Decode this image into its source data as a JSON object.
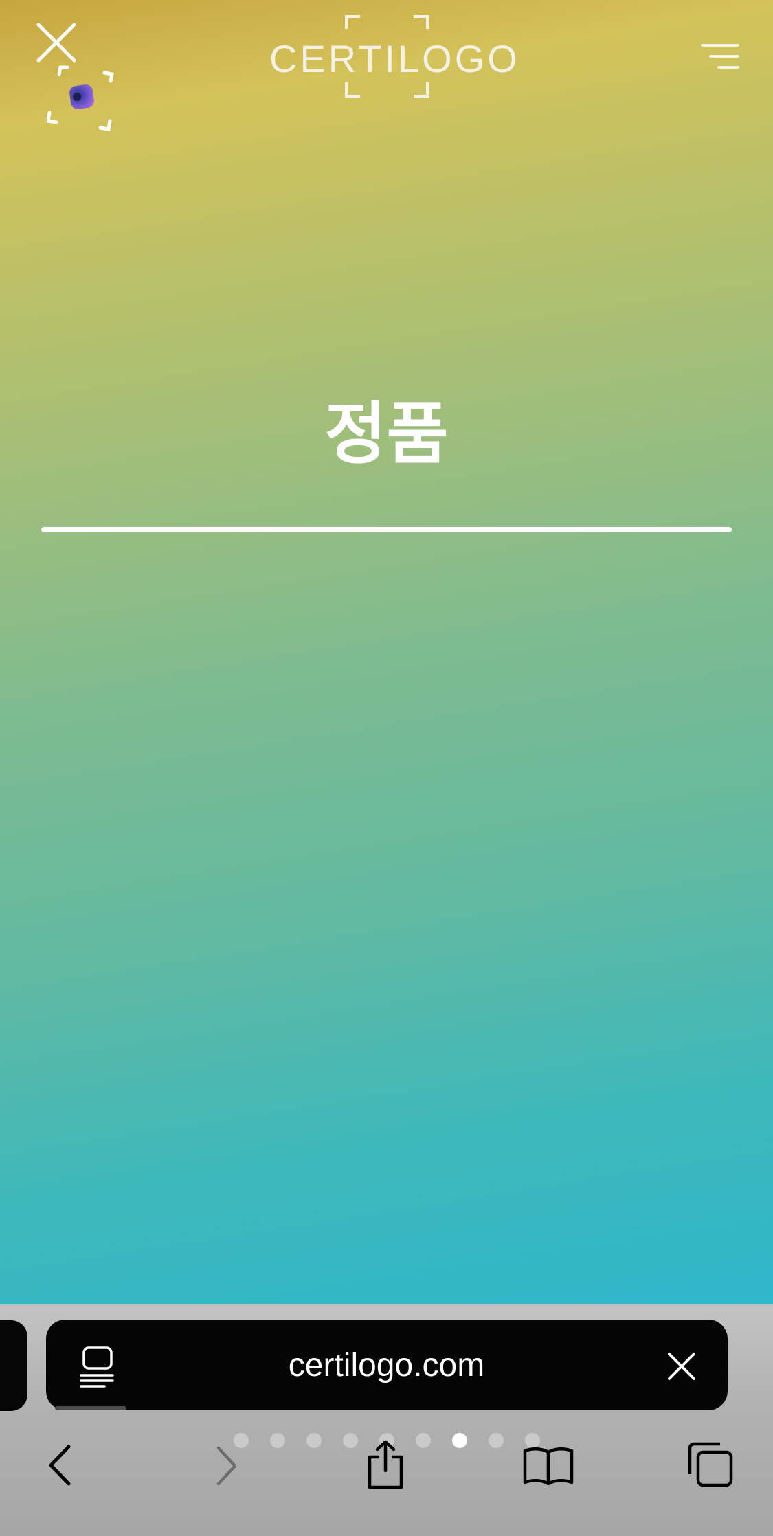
{
  "header": {
    "close_icon": "close-icon",
    "scan_icon": "scan-frame-icon",
    "logo_text": "CERTILOGO",
    "menu_icon": "hamburger-menu-icon"
  },
  "main": {
    "verdict": "정품"
  },
  "browser": {
    "url": "certilogo.com",
    "reader_icon": "reader-mode-icon",
    "clear_icon": "close-icon",
    "tab_count": 9,
    "active_tab_index": 6,
    "toolbar": {
      "back_icon": "chevron-left-icon",
      "forward_icon": "chevron-right-icon",
      "share_icon": "share-icon",
      "bookmarks_icon": "book-icon",
      "tabs_icon": "tabs-icon"
    }
  },
  "colors": {
    "gradient_top": "#c7a53f",
    "gradient_bottom": "#2eb6ca",
    "text": "#ffffff",
    "browser_bar": "#b1b1b1",
    "url_pill": "#050505"
  }
}
